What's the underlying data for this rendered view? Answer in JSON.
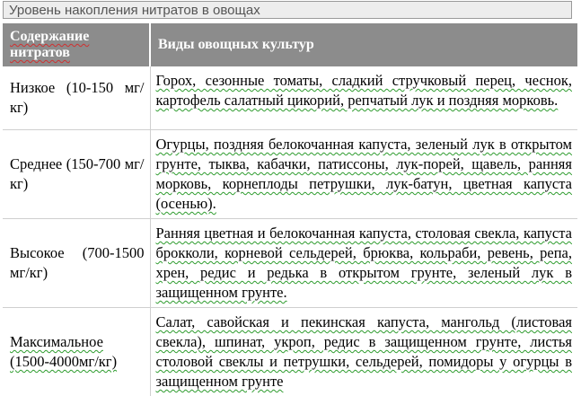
{
  "caption": "Уровень накопления нитратов в овощах",
  "columns": {
    "level": "Содержание нитратов",
    "vegetables": "Виды овощных культур"
  },
  "rows": [
    {
      "level": "Низкое (10-150 мг/кг)",
      "vegetables": "Горох, сезонные томаты, сладкий стручковый перец, чеснок, картофель салатный цикорий, репчатый лук и поздняя морковь."
    },
    {
      "level": "Среднее (150-700 мг/кг)",
      "vegetables": "Огурцы, поздняя белокочанная капуста, зеленый лук в открытом грунте, тыква, кабачки, патиссоны, лук-порей, щавель, ранняя морковь, корнеплоды петрушки, лук-батун, цветная капуста (осенью)."
    },
    {
      "level": "Высокое (700-1500 мг/кг)",
      "vegetables": "Ранняя цветная и белокочанная капуста, столовая свекла, капуста брокколи, корневой сельдерей, брюква, кольраби, ревень, репа, хрен, редис и редька в открытом грунте, зеленый лук в защищенном грунте."
    },
    {
      "level": "Максимальное (1500-4000мг/кг)",
      "vegetables": "Салат, савойская и пекинская капуста, мангольд (листовая свекла), шпинат, укроп, редис в защищенном грунте, листья столовой свеклы и петрушки, сельдерей, помидоры у огурцы в защищенном грунте"
    }
  ]
}
